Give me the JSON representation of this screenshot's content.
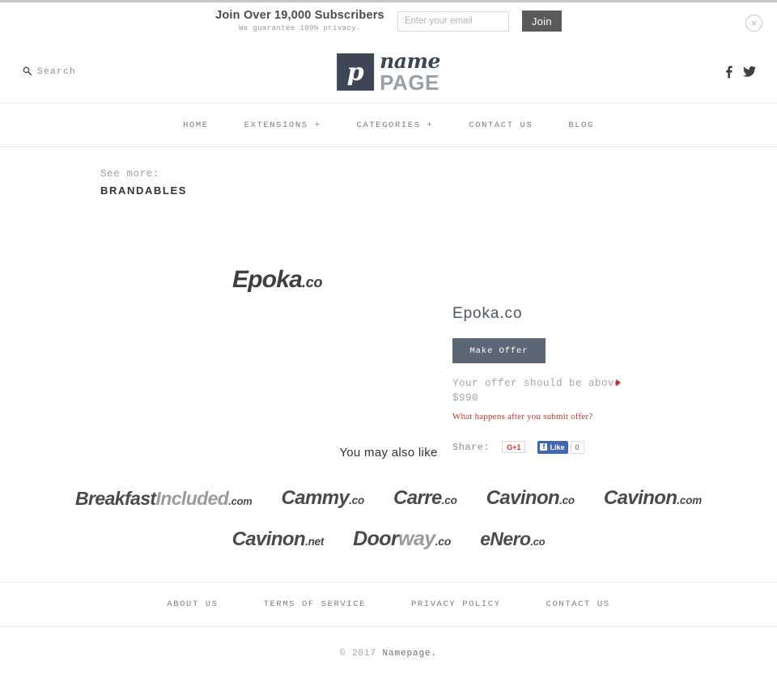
{
  "banner": {
    "headline": "Join Over 19,000 Subscribers",
    "subtext": "We guarantee 100% privacy.",
    "email_placeholder": "Enter your email",
    "email_value": "",
    "join_label": "Join",
    "close_glyph": "×"
  },
  "header": {
    "search_label": "Search",
    "search_glyph": "⌕",
    "logo": {
      "mark_letter": "p",
      "name": "name",
      "page": "PAGE"
    },
    "social": [
      "facebook-icon",
      "twitter-icon"
    ]
  },
  "nav": {
    "items": [
      {
        "label": "HOME"
      },
      {
        "label": "EXTENSIONS +"
      },
      {
        "label": "CATEGORIES +"
      },
      {
        "label": "CONTACT US"
      },
      {
        "label": "BLOG"
      }
    ]
  },
  "breadcrumb": {
    "see_more": "See more:",
    "category": "BRANDABLES"
  },
  "product": {
    "logo_name": "Epoka",
    "logo_tld": ".co",
    "title": "Epoka.co",
    "offer_button": "Make Offer",
    "offer_note": "Your offer should be above $990",
    "offer_minimum": "$990",
    "offer_help_link": "What happens after you submit offer?",
    "share_label": "Share:",
    "gplus_label": "G+1",
    "fb_like_label": "Like",
    "fb_like_count": "0"
  },
  "related": {
    "title": "You may also like",
    "rows": [
      [
        {
          "name": "Breakfast",
          "name_dim": "Included",
          "tld": ".com",
          "size": 23
        },
        {
          "name": "Cammy",
          "name_dim": "",
          "tld": ".co",
          "size": 24
        },
        {
          "name": "Carre",
          "name_dim": "",
          "tld": ".co",
          "size": 24
        },
        {
          "name": "Cavinon",
          "name_dim": "",
          "tld": ".co",
          "size": 24
        },
        {
          "name": "Cavinon",
          "name_dim": "",
          "tld": ".com",
          "size": 24
        }
      ],
      [
        {
          "name": "Cavinon",
          "name_dim": "",
          "tld": ".net",
          "size": 24
        },
        {
          "name": "Door",
          "name_dim": "way",
          "tld": ".co",
          "size": 25
        },
        {
          "name": "eNero",
          "name_dim": "",
          "tld": ".co",
          "size": 23
        }
      ]
    ]
  },
  "footer": {
    "links": [
      {
        "label": "ABOUT US"
      },
      {
        "label": "TERMS OF SERVICE"
      },
      {
        "label": "PRIVACY POLICY"
      },
      {
        "label": "CONTACT US"
      }
    ],
    "copyright_prefix": "© 2017 ",
    "copyright_brand": "Namepage."
  },
  "colors": {
    "logo_navy": "#3c4654",
    "offer_button": "#5b6775",
    "accent_red": "#c0392b",
    "join_button": "#5a5a5a",
    "facebook_blue": "#4267b2"
  }
}
